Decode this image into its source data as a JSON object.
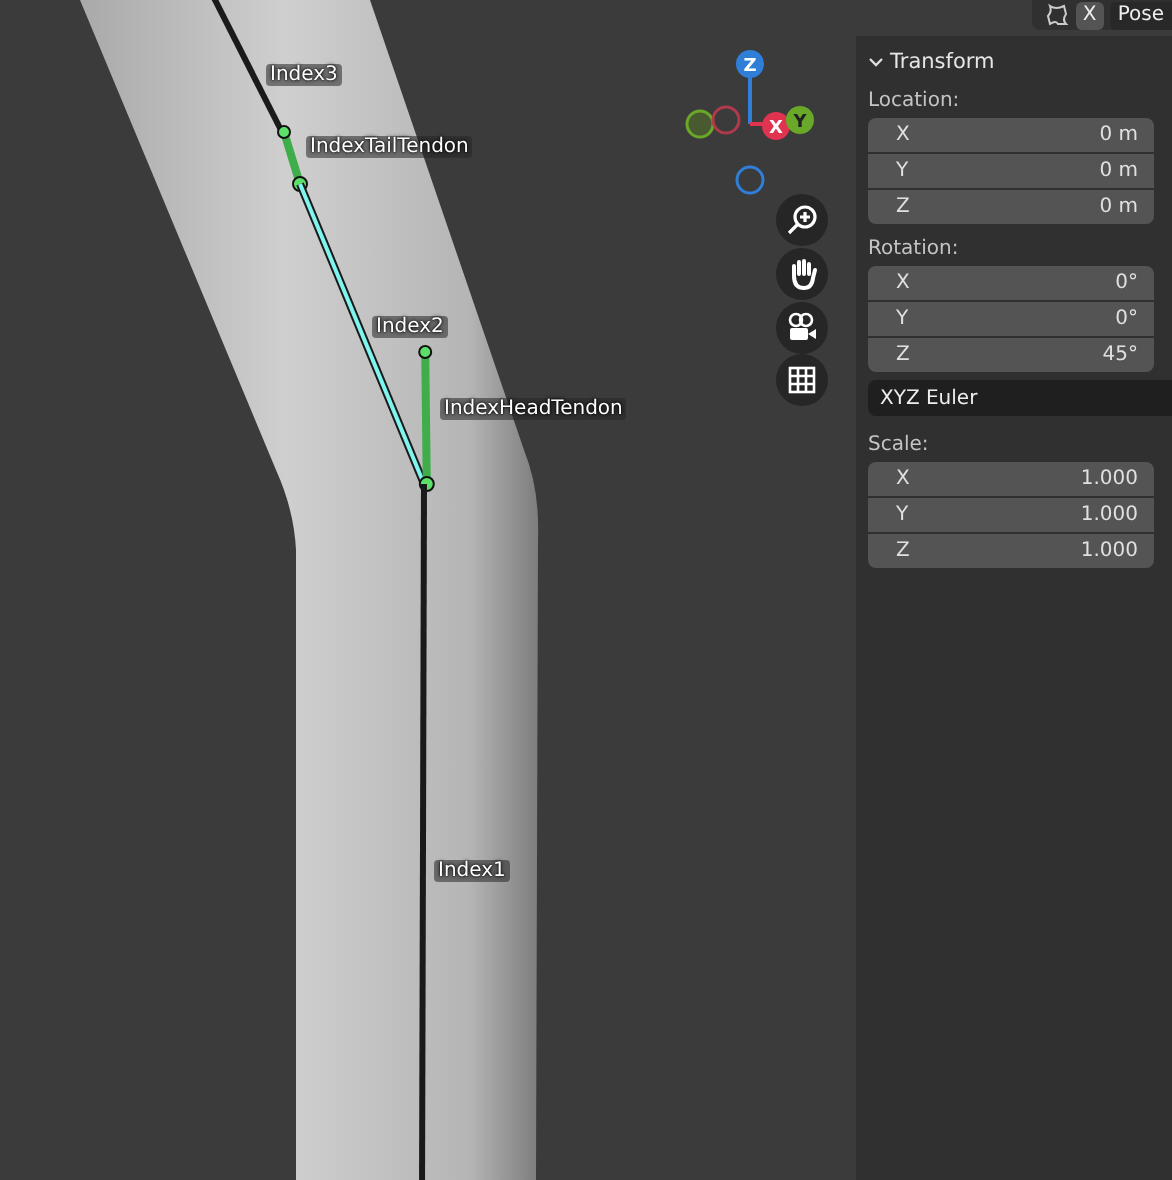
{
  "header": {
    "toggle_label": "X",
    "mode": "Pose"
  },
  "bones": [
    {
      "label": "Index3",
      "color": "#1a1a1a",
      "selected": false
    },
    {
      "label": "IndexTailTendon",
      "color": "#3fae4a",
      "selected": false
    },
    {
      "label": "Index2",
      "color": "#1a1a1a",
      "selected": true
    },
    {
      "label": "IndexHeadTendon",
      "color": "#3fae4a",
      "selected": false
    },
    {
      "label": "Index1",
      "color": "#1a1a1a",
      "selected": false
    }
  ],
  "gizmo": {
    "axes": [
      {
        "label": "Z",
        "kind": "z"
      },
      {
        "label": "X",
        "kind": "x"
      },
      {
        "label": "Y",
        "kind": "y"
      }
    ]
  },
  "panel": {
    "title": "Transform",
    "expanded": true,
    "sections": [
      {
        "kind": "fields",
        "label": "Location:",
        "fields": [
          {
            "axis": "X",
            "value": "0 m"
          },
          {
            "axis": "Y",
            "value": "0 m"
          },
          {
            "axis": "Z",
            "value": "0 m"
          }
        ]
      },
      {
        "kind": "fields",
        "label": "Rotation:",
        "fields": [
          {
            "axis": "X",
            "value": "0°"
          },
          {
            "axis": "Y",
            "value": "0°"
          },
          {
            "axis": "Z",
            "value": "45°"
          }
        ]
      },
      {
        "kind": "dropdown",
        "value": "XYZ Euler"
      },
      {
        "kind": "fields",
        "label": "Scale:",
        "fields": [
          {
            "axis": "X",
            "value": "1.000"
          },
          {
            "axis": "Y",
            "value": "1.000"
          },
          {
            "axis": "Z",
            "value": "1.000"
          }
        ]
      }
    ]
  }
}
